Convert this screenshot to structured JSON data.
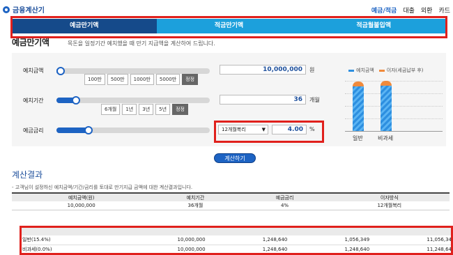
{
  "logo": {
    "text": "금융계산기"
  },
  "topnav": [
    {
      "label": "예금/적금",
      "active": true
    },
    {
      "label": "대출",
      "active": false
    },
    {
      "label": "외환",
      "active": false
    },
    {
      "label": "카드",
      "active": false
    }
  ],
  "tabs": [
    {
      "label": "예금만기액",
      "active": true
    },
    {
      "label": "적금만기액",
      "active": false
    },
    {
      "label": "적금월불입액",
      "active": false
    }
  ],
  "heading": {
    "title": "예금만기액",
    "description": "목돈을 일정기간 예치했을 때 만기 지급액을 계산하여 드립니다."
  },
  "form": {
    "deposit": {
      "label": "예치금액",
      "value": "10,000,000",
      "unit": "원",
      "slider_fraction": 0.02,
      "presets": [
        "100만",
        "500만",
        "1000만",
        "5000만"
      ],
      "edit_label": "정정"
    },
    "period": {
      "label": "예치기간",
      "value": "36",
      "unit": "개월",
      "slider_fraction": 0.12,
      "presets": [
        "6개월",
        "1년",
        "3년",
        "5년"
      ],
      "edit_label": "정정"
    },
    "rate": {
      "label": "예금금리",
      "value": "4.00",
      "unit": "%",
      "slider_fraction": 0.2,
      "compound_option": "12개월복리"
    }
  },
  "mini_chart": {
    "legend": [
      {
        "name": "예치금액",
        "color": "#2d8fe0"
      },
      {
        "name": "이자(세금납부 후)",
        "color": "#f08a3c"
      }
    ],
    "bars": [
      {
        "category": "일반",
        "principal": 10000000,
        "interest": 1056349
      },
      {
        "category": "비과세",
        "principal": 10000000,
        "interest": 1248640
      }
    ]
  },
  "calc_button": {
    "label": "계산하기"
  },
  "result": {
    "title": "계산결과",
    "description": "- 고객님이 설정하신 예치금액/기간/금리를 토대로 만기지급 금액에 대한 계산결과입니다.",
    "summary_headers": [
      "예치금액(원)",
      "예치기간",
      "예금금리",
      "이자방식"
    ],
    "summary_row": [
      "10,000,000",
      "36개월",
      "4%",
      "12개월복리"
    ],
    "detail_rows": [
      [
        "일반(15.4%)",
        "10,000,000",
        "1,248,640",
        "1,056,349",
        "11,056,34"
      ],
      [
        "비과세(0.0%)",
        "10,000,000",
        "1,248,640",
        "1,248,640",
        "11,248,64"
      ]
    ]
  }
}
